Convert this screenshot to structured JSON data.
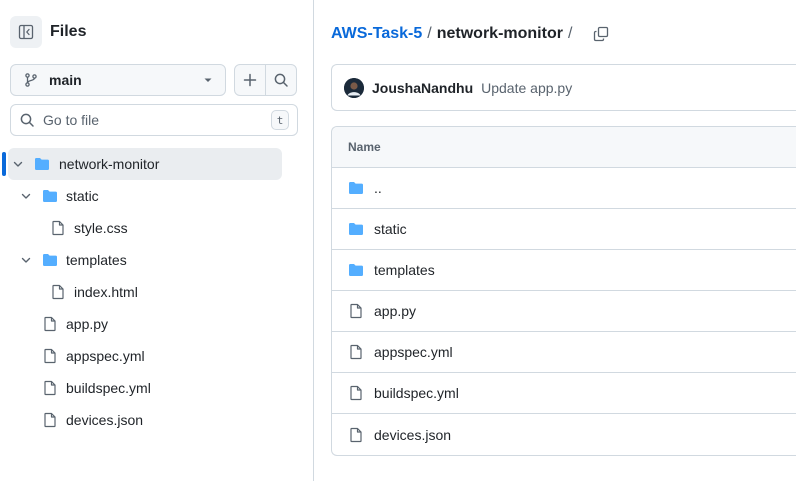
{
  "sidebar": {
    "title": "Files",
    "branch": "main",
    "goto_placeholder": "Go to file",
    "goto_shortcut": "t",
    "tree": {
      "root": "network-monitor",
      "static": "static",
      "style_css": "style.css",
      "templates": "templates",
      "index_html": "index.html",
      "app_py": "app.py",
      "appspec": "appspec.yml",
      "buildspec": "buildspec.yml",
      "devices": "devices.json"
    }
  },
  "breadcrumb": {
    "repo": "AWS-Task-5",
    "separator": "/",
    "folder": "network-monitor",
    "trailing": "/"
  },
  "commit": {
    "author": "JoushaNandhu",
    "message": "Update app.py"
  },
  "file_table": {
    "header": "Name",
    "rows": [
      {
        "name": "..",
        "type": "folder"
      },
      {
        "name": "static",
        "type": "folder"
      },
      {
        "name": "templates",
        "type": "folder"
      },
      {
        "name": "app.py",
        "type": "file"
      },
      {
        "name": "appspec.yml",
        "type": "file"
      },
      {
        "name": "buildspec.yml",
        "type": "file"
      },
      {
        "name": "devices.json",
        "type": "file"
      }
    ]
  },
  "colors": {
    "accent": "#0969da",
    "folder": "#54aeff",
    "border": "#d1d9e0",
    "muted": "#59636e"
  }
}
